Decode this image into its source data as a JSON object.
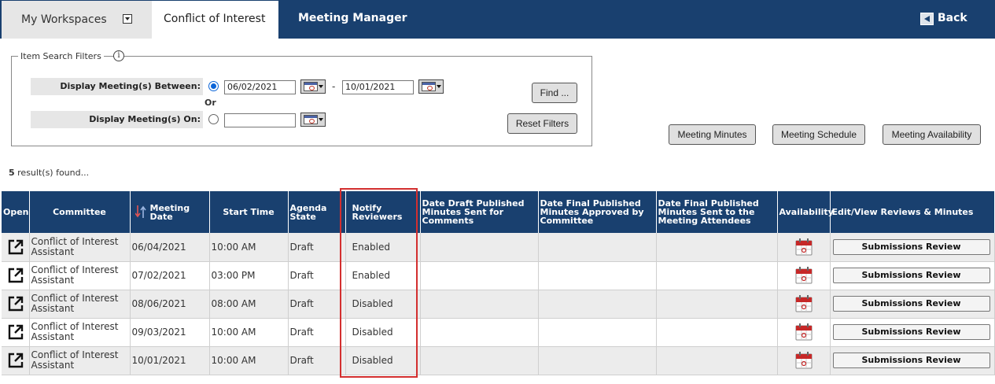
{
  "nav": {
    "tabs": [
      {
        "label": "My Workspaces",
        "active": false,
        "has_dropdown": true
      },
      {
        "label": "Conflict of Interest",
        "active": true
      },
      {
        "label": "Meeting Manager",
        "active": false
      }
    ],
    "back_label": "Back",
    "colors": {
      "bar": "#19406f",
      "inactive_tab": "#e6e6e6",
      "active_tab": "#ffffff"
    }
  },
  "filters": {
    "legend": "Item Search Filters",
    "info_icon": "info-icon",
    "between_label": "Display Meeting(s) Between:",
    "between_selected": true,
    "date_from": "06/02/2021",
    "date_separator": "-",
    "date_to": "10/01/2021",
    "or_label": "Or",
    "on_label": "Display Meeting(s) On:",
    "on_selected": false,
    "date_on": "",
    "find_label": "Find ...",
    "reset_label": "Reset Filters"
  },
  "actions": {
    "minutes_label": "Meeting Minutes",
    "schedule_label": "Meeting Schedule",
    "availability_label": "Meeting Availability"
  },
  "results": {
    "count": "5",
    "suffix": " result(s) found..."
  },
  "table": {
    "headers": {
      "open": "Open",
      "committee": "Committee",
      "meeting_date": "Meeting Date",
      "start_time": "Start Time",
      "agenda_state": "Agenda State",
      "notify_reviewers": "Notify Reviewers",
      "draft_published": "Date Draft Published Minutes Sent for Comments",
      "final_published": "Date Final Published Minutes Approved by Committee",
      "final_sent": "Date Final Published Minutes Sent to the Meeting Attendees",
      "availability": "Availability",
      "edit_view": "Edit/View Reviews & Minutes"
    },
    "rows": [
      {
        "committee": "Conflict of Interest Assistant",
        "date": "06/04/2021",
        "time": "10:00 AM",
        "state": "Draft",
        "notify": "Enabled",
        "draft": "",
        "final": "",
        "sent": "",
        "action": "Submissions Review"
      },
      {
        "committee": "Conflict of Interest Assistant",
        "date": "07/02/2021",
        "time": "03:00 PM",
        "state": "Draft",
        "notify": "Enabled",
        "draft": "",
        "final": "",
        "sent": "",
        "action": "Submissions Review"
      },
      {
        "committee": "Conflict of Interest Assistant",
        "date": "08/06/2021",
        "time": "08:00 AM",
        "state": "Draft",
        "notify": "Disabled",
        "draft": "",
        "final": "",
        "sent": "",
        "action": "Submissions Review"
      },
      {
        "committee": "Conflict of Interest Assistant",
        "date": "09/03/2021",
        "time": "10:00 AM",
        "state": "Draft",
        "notify": "Disabled",
        "draft": "",
        "final": "",
        "sent": "",
        "action": "Submissions Review"
      },
      {
        "committee": "Conflict of Interest Assistant",
        "date": "10/01/2021",
        "time": "10:00 AM",
        "state": "Draft",
        "notify": "Disabled",
        "draft": "",
        "final": "",
        "sent": "",
        "action": "Submissions Review"
      }
    ],
    "highlight_color": "#d32f2f"
  }
}
